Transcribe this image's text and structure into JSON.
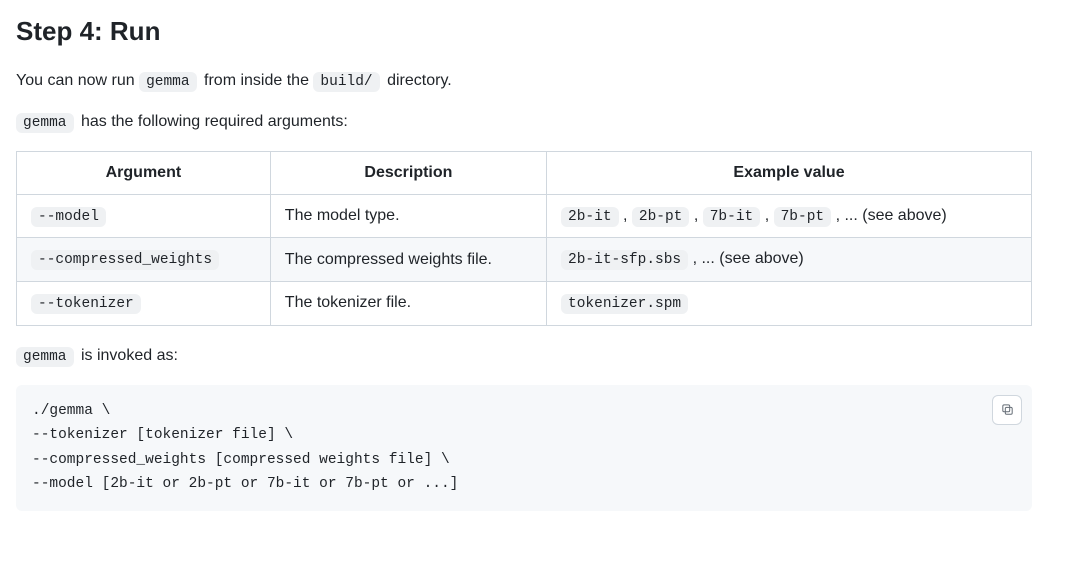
{
  "heading": "Step 4: Run",
  "intro": {
    "before_cmd": "You can now run ",
    "cmd": "gemma",
    "mid": " from inside the ",
    "dir": "build/",
    "after": " directory."
  },
  "args_line": {
    "cmd": "gemma",
    "after": " has the following required arguments:"
  },
  "table": {
    "headers": [
      "Argument",
      "Description",
      "Example value"
    ],
    "rows": [
      {
        "arg": "--model",
        "desc": "The model type.",
        "example_codes": [
          "2b-it",
          "2b-pt",
          "7b-it",
          "7b-pt"
        ],
        "example_suffix": ", ... (see above)"
      },
      {
        "arg": "--compressed_weights",
        "desc": "The compressed weights file.",
        "example_codes": [
          "2b-it-sfp.sbs"
        ],
        "example_suffix": ", ... (see above)"
      },
      {
        "arg": "--tokenizer",
        "desc": "The tokenizer file.",
        "example_codes": [
          "tokenizer.spm"
        ],
        "example_suffix": ""
      }
    ]
  },
  "invoke_line": {
    "cmd": "gemma",
    "after": " is invoked as:"
  },
  "codeblock": "./gemma \\\n--tokenizer [tokenizer file] \\\n--compressed_weights [compressed weights file] \\\n--model [2b-it or 2b-pt or 7b-it or 7b-pt or ...]"
}
